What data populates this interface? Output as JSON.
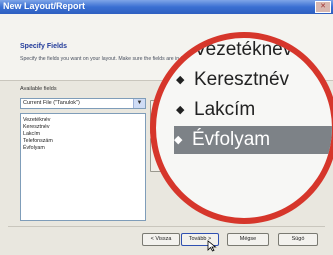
{
  "window": {
    "title": "New Layout/Report",
    "close_glyph": "✕"
  },
  "header": {
    "heading": "Specify Fields",
    "description": "Specify the fields you want on your layout. Make sure the fields are in the order you want them to appear on your layout."
  },
  "available": {
    "label": "Available fields",
    "source_value": "Current File (\"Tanulok\")",
    "items": [
      "Vezetéknév",
      "Keresztnév",
      "Lakcím",
      "Telefonszám",
      "Évfolyam"
    ]
  },
  "zoom": {
    "items": [
      {
        "label": "Vezetéknév",
        "selected": false
      },
      {
        "label": "Keresztnév",
        "selected": false
      },
      {
        "label": "Lakcím",
        "selected": false
      },
      {
        "label": "Évfolyam",
        "selected": true
      }
    ],
    "bullet": "◆",
    "accent_color": "#d6362b"
  },
  "buttons": {
    "back": "< Vissza",
    "next": "Tovább >",
    "cancel": "Mégse",
    "finish": "Súgó"
  },
  "icons": {
    "close": "close-icon",
    "dropdown": "chevron-down-icon",
    "cursor": "mouse-pointer-icon"
  }
}
